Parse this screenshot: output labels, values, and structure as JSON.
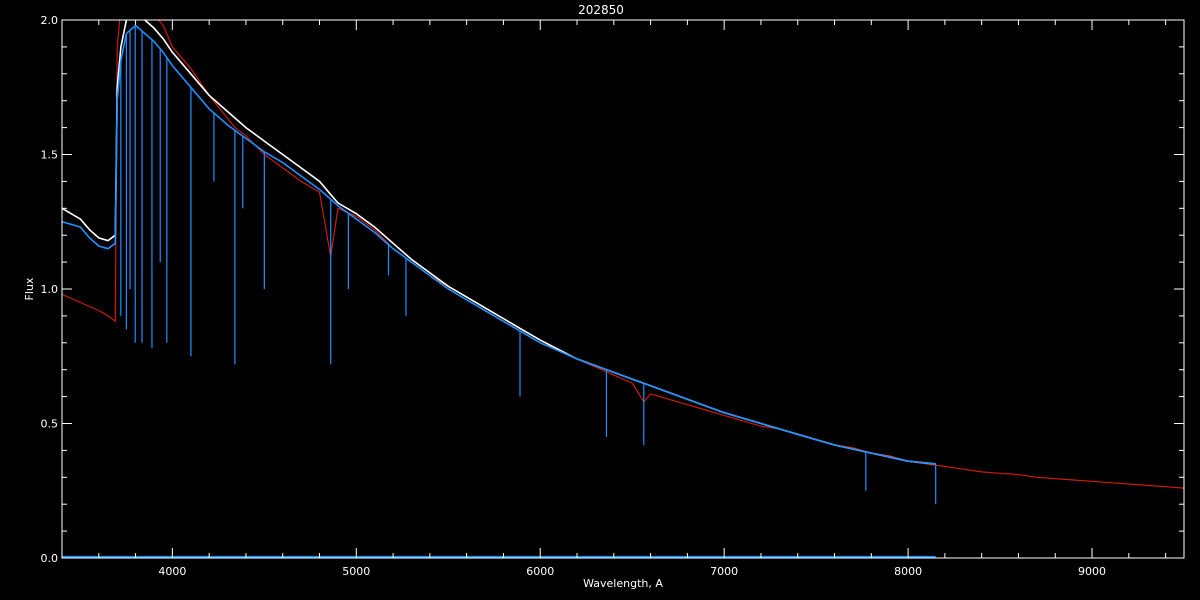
{
  "chart_data": {
    "type": "line",
    "title": "202850",
    "xlabel": "Wavelength, A",
    "ylabel": "Flux",
    "xlim": [
      3400,
      9500
    ],
    "ylim": [
      0.0,
      2.0
    ],
    "x_ticks": [
      4000,
      5000,
      6000,
      7000,
      8000,
      9000
    ],
    "y_ticks": [
      0.0,
      0.5,
      1.0,
      1.5,
      2.0
    ],
    "y_tick_labels": [
      "0.0",
      "0.5",
      "1.0",
      "1.5",
      "2.0"
    ],
    "grid": false,
    "legend": "none",
    "colors": {
      "background": "#000000",
      "axes": "#ffffff",
      "observed_white": "#ffffff",
      "observed_blue": "#1e90ff",
      "model_red": "#cc1b12"
    },
    "series": [
      {
        "color": "#cc1b12",
        "x": [
          3400,
          3500,
          3600,
          3650,
          3690,
          3700,
          3720,
          3750,
          3800,
          3850,
          3900,
          3950,
          4000,
          4100,
          4200,
          4340,
          4400,
          4500,
          4600,
          4700,
          4800,
          4861,
          4900,
          5000,
          5100,
          5200,
          5300,
          5400,
          5500,
          5600,
          5700,
          5800,
          5900,
          6000,
          6100,
          6200,
          6300,
          6400,
          6500,
          6563,
          6600,
          6700,
          6800,
          6900,
          7000,
          7100,
          7200,
          7300,
          7400,
          7500,
          7600,
          7700,
          7800,
          7900,
          8000,
          8100,
          8200,
          8300,
          8400,
          8500,
          8600,
          8700,
          8800,
          8900,
          9000,
          9100,
          9200,
          9300,
          9400,
          9500
        ],
        "y": [
          0.98,
          0.95,
          0.92,
          0.9,
          0.88,
          1.9,
          2.05,
          2.0,
          2.1,
          2.05,
          2.02,
          1.98,
          1.9,
          1.82,
          1.72,
          1.6,
          1.57,
          1.5,
          1.45,
          1.4,
          1.36,
          1.12,
          1.3,
          1.27,
          1.22,
          1.15,
          1.1,
          1.05,
          1.01,
          0.97,
          0.93,
          0.89,
          0.85,
          0.81,
          0.77,
          0.74,
          0.71,
          0.68,
          0.65,
          0.58,
          0.61,
          0.59,
          0.57,
          0.55,
          0.53,
          0.51,
          0.49,
          0.48,
          0.46,
          0.44,
          0.42,
          0.41,
          0.39,
          0.38,
          0.36,
          0.35,
          0.34,
          0.33,
          0.32,
          0.315,
          0.31,
          0.3,
          0.295,
          0.29,
          0.285,
          0.28,
          0.275,
          0.27,
          0.265,
          0.26
        ]
      },
      {
        "color": "#ffffff",
        "x": [
          3400,
          3450,
          3500,
          3550,
          3600,
          3650,
          3690,
          3700,
          3720,
          3750,
          3800,
          3850,
          3900,
          3950,
          4000,
          4100,
          4200,
          4300,
          4400,
          4500,
          4600,
          4700,
          4800,
          4850,
          4900,
          5000,
          5100,
          5200,
          5300,
          5400,
          5500,
          5600,
          5700,
          5800,
          5900,
          6000,
          6200,
          6400,
          6600,
          6800,
          7000,
          7200,
          7400,
          7600,
          7800,
          8000,
          8150
        ],
        "y": [
          1.3,
          1.28,
          1.26,
          1.22,
          1.19,
          1.18,
          1.2,
          1.75,
          1.9,
          2.0,
          2.05,
          2.0,
          1.97,
          1.93,
          1.88,
          1.8,
          1.72,
          1.66,
          1.6,
          1.55,
          1.5,
          1.45,
          1.4,
          1.36,
          1.32,
          1.28,
          1.23,
          1.17,
          1.11,
          1.06,
          1.01,
          0.97,
          0.93,
          0.89,
          0.85,
          0.81,
          0.74,
          0.69,
          0.64,
          0.59,
          0.54,
          0.5,
          0.46,
          0.42,
          0.39,
          0.36,
          0.35
        ]
      },
      {
        "color": "#1e90ff",
        "x": [
          3400,
          3450,
          3500,
          3550,
          3600,
          3650,
          3690,
          3700,
          3720,
          3750,
          3800,
          3850,
          3900,
          3950,
          4000,
          4100,
          4200,
          4300,
          4400,
          4500,
          4600,
          4700,
          4800,
          4850,
          4900,
          5000,
          5100,
          5200,
          5300,
          5400,
          5500,
          5600,
          5700,
          5800,
          5900,
          6000,
          6200,
          6400,
          6600,
          6800,
          7000,
          7200,
          7400,
          7600,
          7800,
          8000,
          8150
        ],
        "y": [
          1.25,
          1.24,
          1.23,
          1.19,
          1.16,
          1.15,
          1.17,
          1.7,
          1.85,
          1.95,
          1.98,
          1.95,
          1.92,
          1.88,
          1.83,
          1.75,
          1.67,
          1.61,
          1.56,
          1.51,
          1.47,
          1.42,
          1.37,
          1.34,
          1.31,
          1.26,
          1.21,
          1.15,
          1.1,
          1.05,
          1.0,
          0.96,
          0.92,
          0.88,
          0.84,
          0.8,
          0.74,
          0.69,
          0.64,
          0.59,
          0.54,
          0.5,
          0.46,
          0.42,
          0.39,
          0.36,
          0.35
        ]
      },
      {
        "color": "#1e90ff",
        "x": [
          3400,
          8150
        ],
        "y": [
          0.005,
          0.005
        ]
      }
    ],
    "absorption_lines": [
      {
        "x": 3720,
        "y": 0.9
      },
      {
        "x": 3750,
        "y": 0.85
      },
      {
        "x": 3770,
        "y": 1.0
      },
      {
        "x": 3798,
        "y": 0.8
      },
      {
        "x": 3835,
        "y": 0.8
      },
      {
        "x": 3889,
        "y": 0.78
      },
      {
        "x": 3934,
        "y": 1.1
      },
      {
        "x": 3970,
        "y": 0.8
      },
      {
        "x": 4101,
        "y": 0.75
      },
      {
        "x": 4226,
        "y": 1.4
      },
      {
        "x": 4340,
        "y": 0.72
      },
      {
        "x": 4383,
        "y": 1.3
      },
      {
        "x": 4500,
        "y": 1.0
      },
      {
        "x": 4861,
        "y": 0.72
      },
      {
        "x": 4957,
        "y": 1.0
      },
      {
        "x": 5175,
        "y": 1.05
      },
      {
        "x": 5270,
        "y": 0.9
      },
      {
        "x": 5890,
        "y": 0.6
      },
      {
        "x": 6360,
        "y": 0.45
      },
      {
        "x": 6563,
        "y": 0.42
      },
      {
        "x": 7770,
        "y": 0.25
      },
      {
        "x": 8150,
        "y": 0.2
      }
    ]
  }
}
